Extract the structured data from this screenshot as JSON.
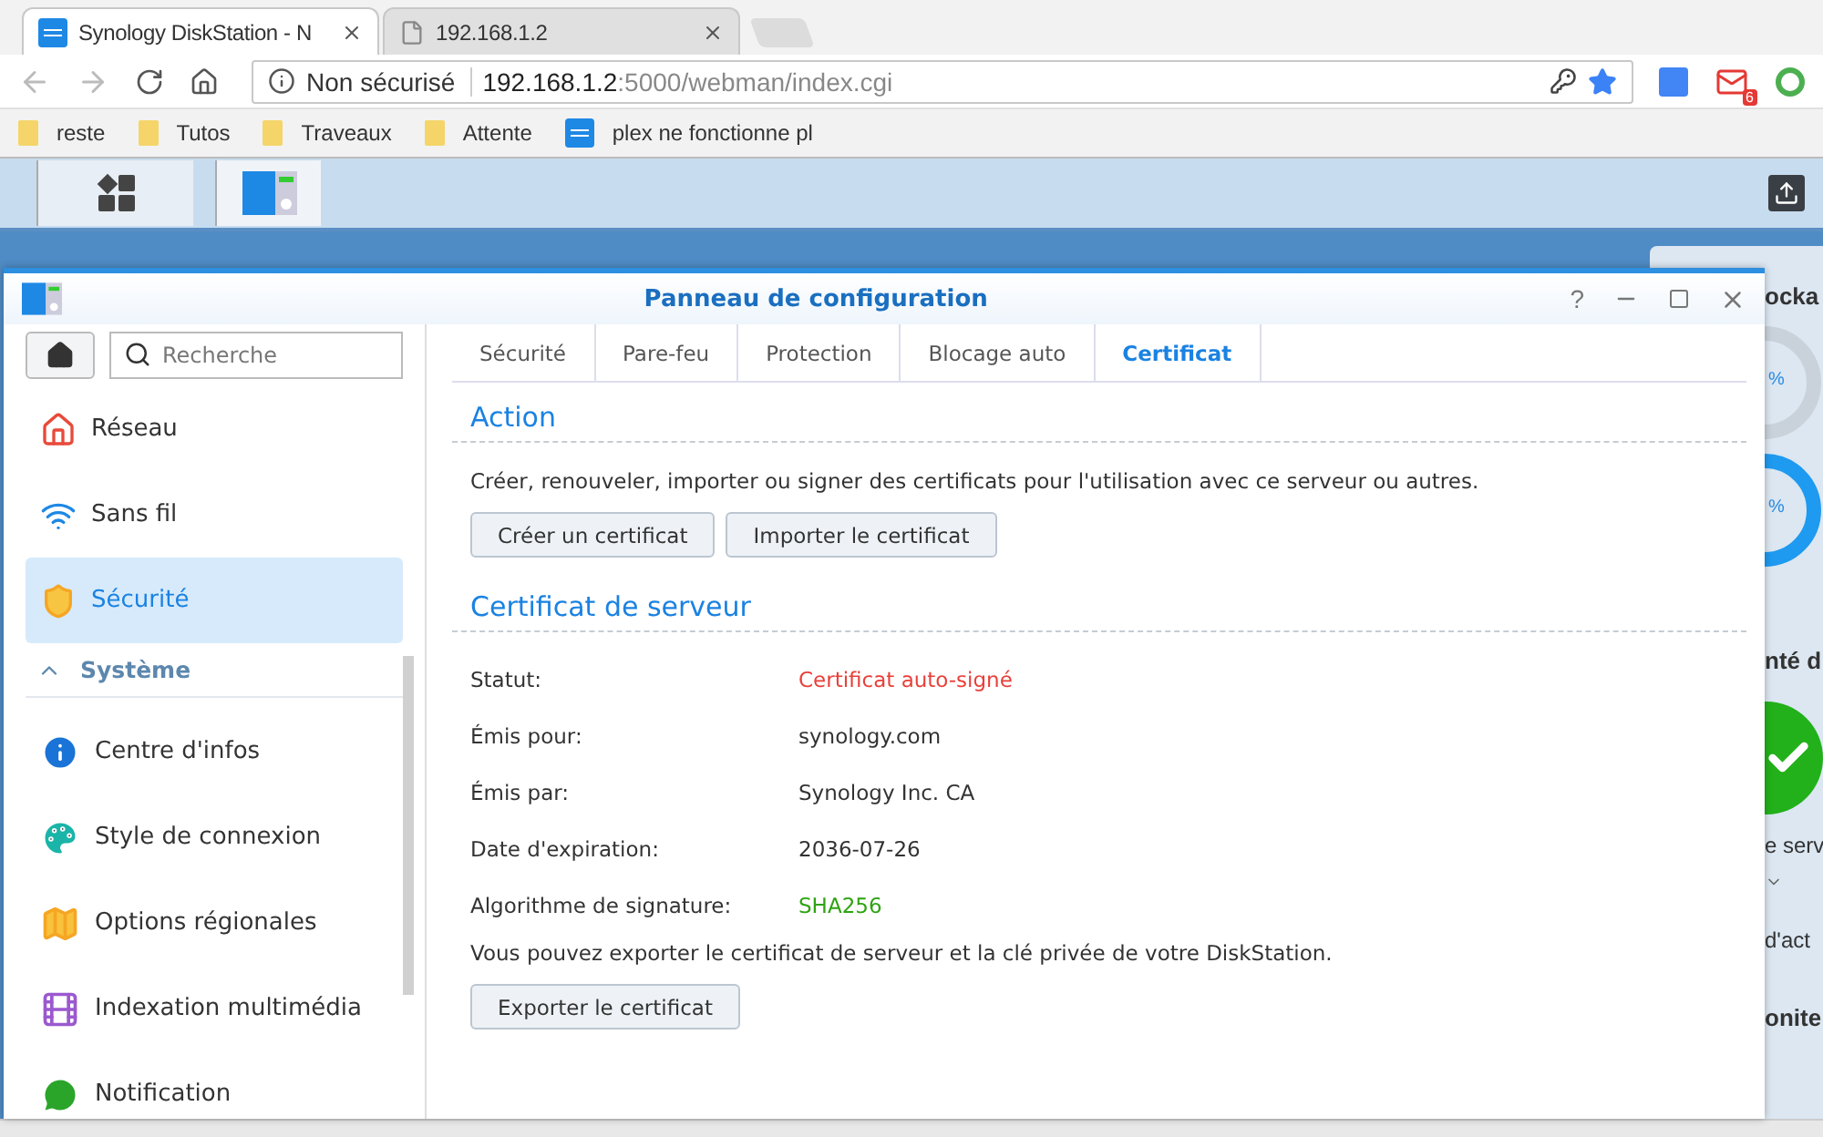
{
  "browser": {
    "tabs": [
      {
        "title": "Synology DiskStation - N",
        "selected": true,
        "kind": "dsm"
      },
      {
        "title": "192.168.1.2",
        "selected": false,
        "kind": "page"
      }
    ],
    "address": {
      "security": "Non sécurisé",
      "host": "192.168.1.2",
      "path": ":5000/webman/index.cgi"
    },
    "mail_badge": "6",
    "bookmarks": [
      {
        "label": "reste",
        "kind": "folder"
      },
      {
        "label": "Tutos",
        "kind": "folder"
      },
      {
        "label": "Traveaux",
        "kind": "folder"
      },
      {
        "label": "Attente",
        "kind": "folder"
      },
      {
        "label": "plex ne fonctionne pl",
        "kind": "dsm"
      }
    ]
  },
  "window": {
    "title": "Panneau de configuration",
    "help": "?",
    "search": {
      "placeholder": "Recherche"
    },
    "sidebar": [
      {
        "kind": "item",
        "label": "Réseau",
        "selected": false
      },
      {
        "kind": "item",
        "label": "Sans fil",
        "selected": false
      },
      {
        "kind": "item",
        "label": "Sécurité",
        "selected": true
      },
      {
        "kind": "section",
        "label": "Système",
        "expanded": true
      },
      {
        "kind": "item",
        "label": "Centre d'infos",
        "selected": false
      },
      {
        "kind": "item",
        "label": "Style de connexion",
        "selected": false
      },
      {
        "kind": "item",
        "label": "Options régionales",
        "selected": false
      },
      {
        "kind": "item",
        "label": "Indexation multimédia",
        "selected": false
      },
      {
        "kind": "item",
        "label": "Notification",
        "selected": false
      }
    ],
    "tabs": [
      {
        "label": "Sécurité",
        "selected": false
      },
      {
        "label": "Pare-feu",
        "selected": false
      },
      {
        "label": "Protection",
        "selected": false
      },
      {
        "label": "Blocage auto",
        "selected": false
      },
      {
        "label": "Certificat",
        "selected": true
      }
    ],
    "action": {
      "heading": "Action",
      "text": "Créer, renouveler, importer ou signer des certificats pour l'utilisation avec ce serveur ou autres.",
      "buttons": [
        "Créer un certificat",
        "Importer le certificat"
      ]
    },
    "server_certificate": {
      "heading": "Certificat de serveur",
      "rows": [
        {
          "label": "Statut:",
          "value": "Certificat auto-signé",
          "color": "#e8403a"
        },
        {
          "label": "Émis pour:",
          "value": "synology.com",
          "color": "#333333"
        },
        {
          "label": "Émis par:",
          "value": "Synology Inc. CA",
          "color": "#333333"
        },
        {
          "label": "Date d'expiration:",
          "value": "2036-07-26",
          "color": "#333333"
        },
        {
          "label": "Algorithme de signature:",
          "value": "SHA256",
          "color": "#2ea311"
        }
      ],
      "note": "Vous pouvez exporter le certificat de serveur et la clé privée de votre DiskStation.",
      "button": "Exporter le certificat"
    }
  },
  "widgets": {
    "storage_title": "ocka",
    "donut_units": [
      "%",
      "%"
    ],
    "health_title": "nté d",
    "health_text": "e serv",
    "activity": "d'act",
    "monitor_title": "onite"
  }
}
